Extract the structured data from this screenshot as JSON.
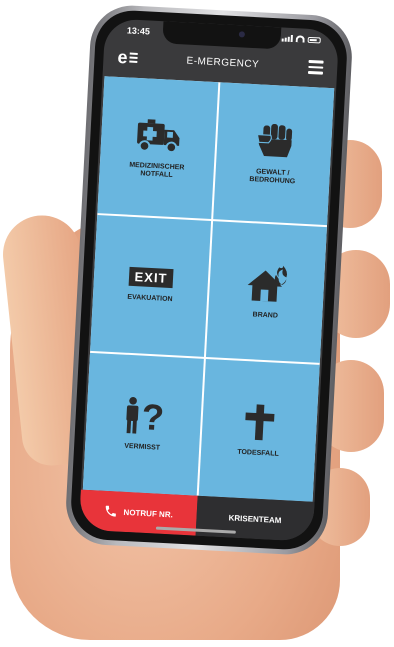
{
  "status": {
    "time": "13:45"
  },
  "app": {
    "title": "E-MERGENCY",
    "logo_letter": "e"
  },
  "tiles": [
    {
      "label": "MEDIZINISCHER NOTFALL",
      "icon": "ambulance-icon"
    },
    {
      "label": "GEWALT / BEDROHUNG",
      "icon": "fist-icon"
    },
    {
      "label": "EVAKUATION",
      "icon": "exit-sign-icon",
      "sign_text": "EXIT"
    },
    {
      "label": "BRAND",
      "icon": "house-fire-icon"
    },
    {
      "label": "VERMISST",
      "icon": "missing-person-icon"
    },
    {
      "label": "TODESFALL",
      "icon": "cross-icon"
    }
  ],
  "bottom": {
    "notruf_label": "NOTRUF NR.",
    "krisen_label": "KRISENTEAM"
  },
  "colors": {
    "tile": "#69b6df",
    "emergency": "#e8343a",
    "bar": "#2e2e30"
  }
}
